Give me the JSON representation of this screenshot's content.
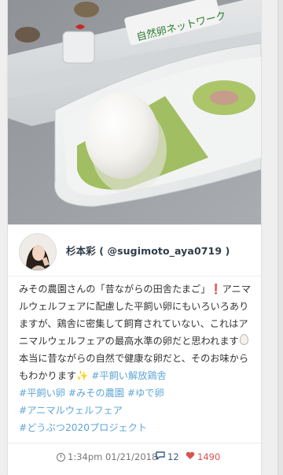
{
  "photo": {
    "alt_label": "egg carton and boiled egg on dish",
    "carton_logo_text": "自然卵ネットワーク"
  },
  "author": {
    "display": "杉本彩 ( @sugimoto_aya0719 )"
  },
  "post": {
    "segments": [
      {
        "type": "text",
        "value": "みその農園さんの「昔ながらの田舎たまご」"
      },
      {
        "type": "icon",
        "name": "exclamation-icon",
        "value": "❗"
      },
      {
        "type": "text",
        "value": "アニマルウェルフェアに配慮した平飼い卵にもいろいろありますが、鶏舎に密集して飼育されていない、これはアニマルウェルフェアの最高水準の卵だと思われます"
      },
      {
        "type": "icon",
        "name": "egg-icon",
        "value": ""
      },
      {
        "type": "text",
        "value": "本当に昔ながらの自然で健康な卵だと、そのお味からもわかります"
      },
      {
        "type": "icon",
        "name": "sparkles-icon",
        "value": "✨"
      }
    ],
    "hashtags": [
      "#平飼い解放鶏舎",
      "#平飼い卵",
      "#みその農園",
      "#ゆで卵",
      "#アニマルウェルフェア",
      "#どうぶつ2020プロジェクト"
    ]
  },
  "footer": {
    "timestamp": "1:34pm 01/21/2018",
    "comments": "12",
    "likes": "1490"
  },
  "colors": {
    "hashtag": "#5fa6d6",
    "like": "#d9534f",
    "comment": "#3a5a8c",
    "name": "#2f3d4a"
  }
}
